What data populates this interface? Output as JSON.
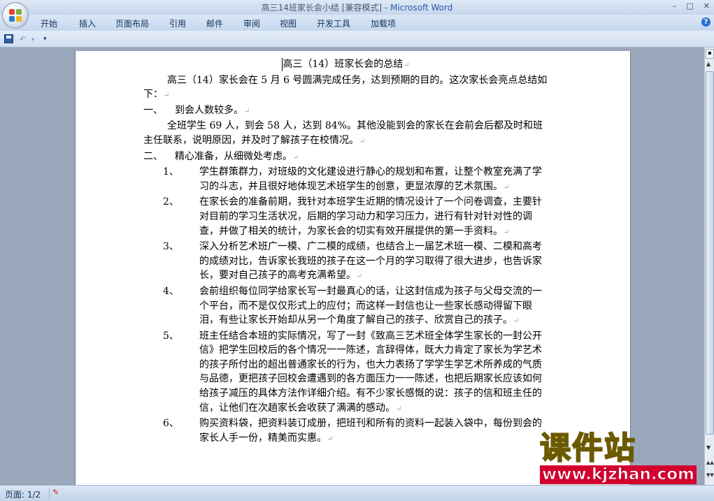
{
  "window": {
    "title_doc": "高三14班家长会小结 [兼容模式] - ",
    "title_app": "Microsoft Word",
    "btn_minimize": "–",
    "btn_restore": "□",
    "btn_close": "✕"
  },
  "ribbon": {
    "tabs": [
      "开始",
      "插入",
      "页面布局",
      "引用",
      "邮件",
      "审阅",
      "视图",
      "开发工具",
      "加载项"
    ],
    "help": "?"
  },
  "qat": {
    "undo": "↶",
    "undo_drop": "▾",
    "more": "▾"
  },
  "document": {
    "title": "高三（14）班家长会的总结",
    "intro": "高三（14）家长会在 5 月 6 号圆满完成任务，达到预期的目的。这次家长会亮点总结如下：",
    "section1": {
      "num": "一、",
      "text": "到会人数较多。"
    },
    "section1_body": "全班学生 69 人，到会 58 人，达到 84%。其他没能到会的家长在会前会后都及时和班主任联系，说明原因，并及时了解孩子在校情况。",
    "section2": {
      "num": "二、",
      "text": "精心准备，从细微处考虑。"
    },
    "items": [
      {
        "num": "1、",
        "text": "学生群策群力，对班级的文化建设进行静心的规划和布置，让整个教室充满了学习的斗志，并且很好地体现艺术班学生的创意，更显浓厚的艺术氛围。"
      },
      {
        "num": "2、",
        "text": "在家长会的准备前期，我针对本班学生近期的情况设计了一个问卷调查，主要针对目前的学习生活状况，后期的学习动力和学习压力，进行有针对针对性的调查，并做了相关的统计，为家长会的切实有效开展提供的第一手资料。"
      },
      {
        "num": "3、",
        "text": "深入分析艺术班广一模、广二模的成绩，也结合上一届艺术班一模、二模和高考的成绩对比，告诉家长我班的孩子在这一个月的学习取得了很大进步，也告诉家长，要对自己孩子的高考充满希望。"
      },
      {
        "num": "4、",
        "text": "会前组织每位同学给家长写一封最真心的话，让这封信成为孩子与父母交流的一个平台，而不是仅仅形式上的应付；而这样一封信也让一些家长感动得留下眼泪，有些让家长开始却从另一个角度了解自己的孩子、欣赏自己的孩子。"
      },
      {
        "num": "5、",
        "text": "班主任结合本班的实际情况，写了一封《致高三艺术班全体学生家长的一封公开信》把学生回校后的各个情况一一陈述，言辞得体，既大力肯定了家长为学艺术的孩子所付出的超出普通家长的行为，也大力表扬了学学生学艺术所养成的气质与品德，更把孩子回校会遭遇到的各方面压力一一陈述，也把后期家长应该如何给孩子减压的具体方法作详细介绍。有不少家长感慨的说：孩子的信和班主任的信，让他们在次趟家长会收获了满满的感动。"
      },
      {
        "num": "6、",
        "text": "购买资料袋，把资料装订成册，把班刊和所有的资料一起装入袋中，每份到会的家长人手一份，精美而实惠。"
      }
    ],
    "para_mark": "↵"
  },
  "scrollbar": {
    "ruler": "▪",
    "up": "▲",
    "down": "▼",
    "prev": "▲▲",
    "next": "▼▼"
  },
  "status": {
    "page": "页面: 1/2",
    "icon": "✎"
  },
  "watermark": {
    "main": "课件站",
    "url": "www.kjzhan.com"
  }
}
